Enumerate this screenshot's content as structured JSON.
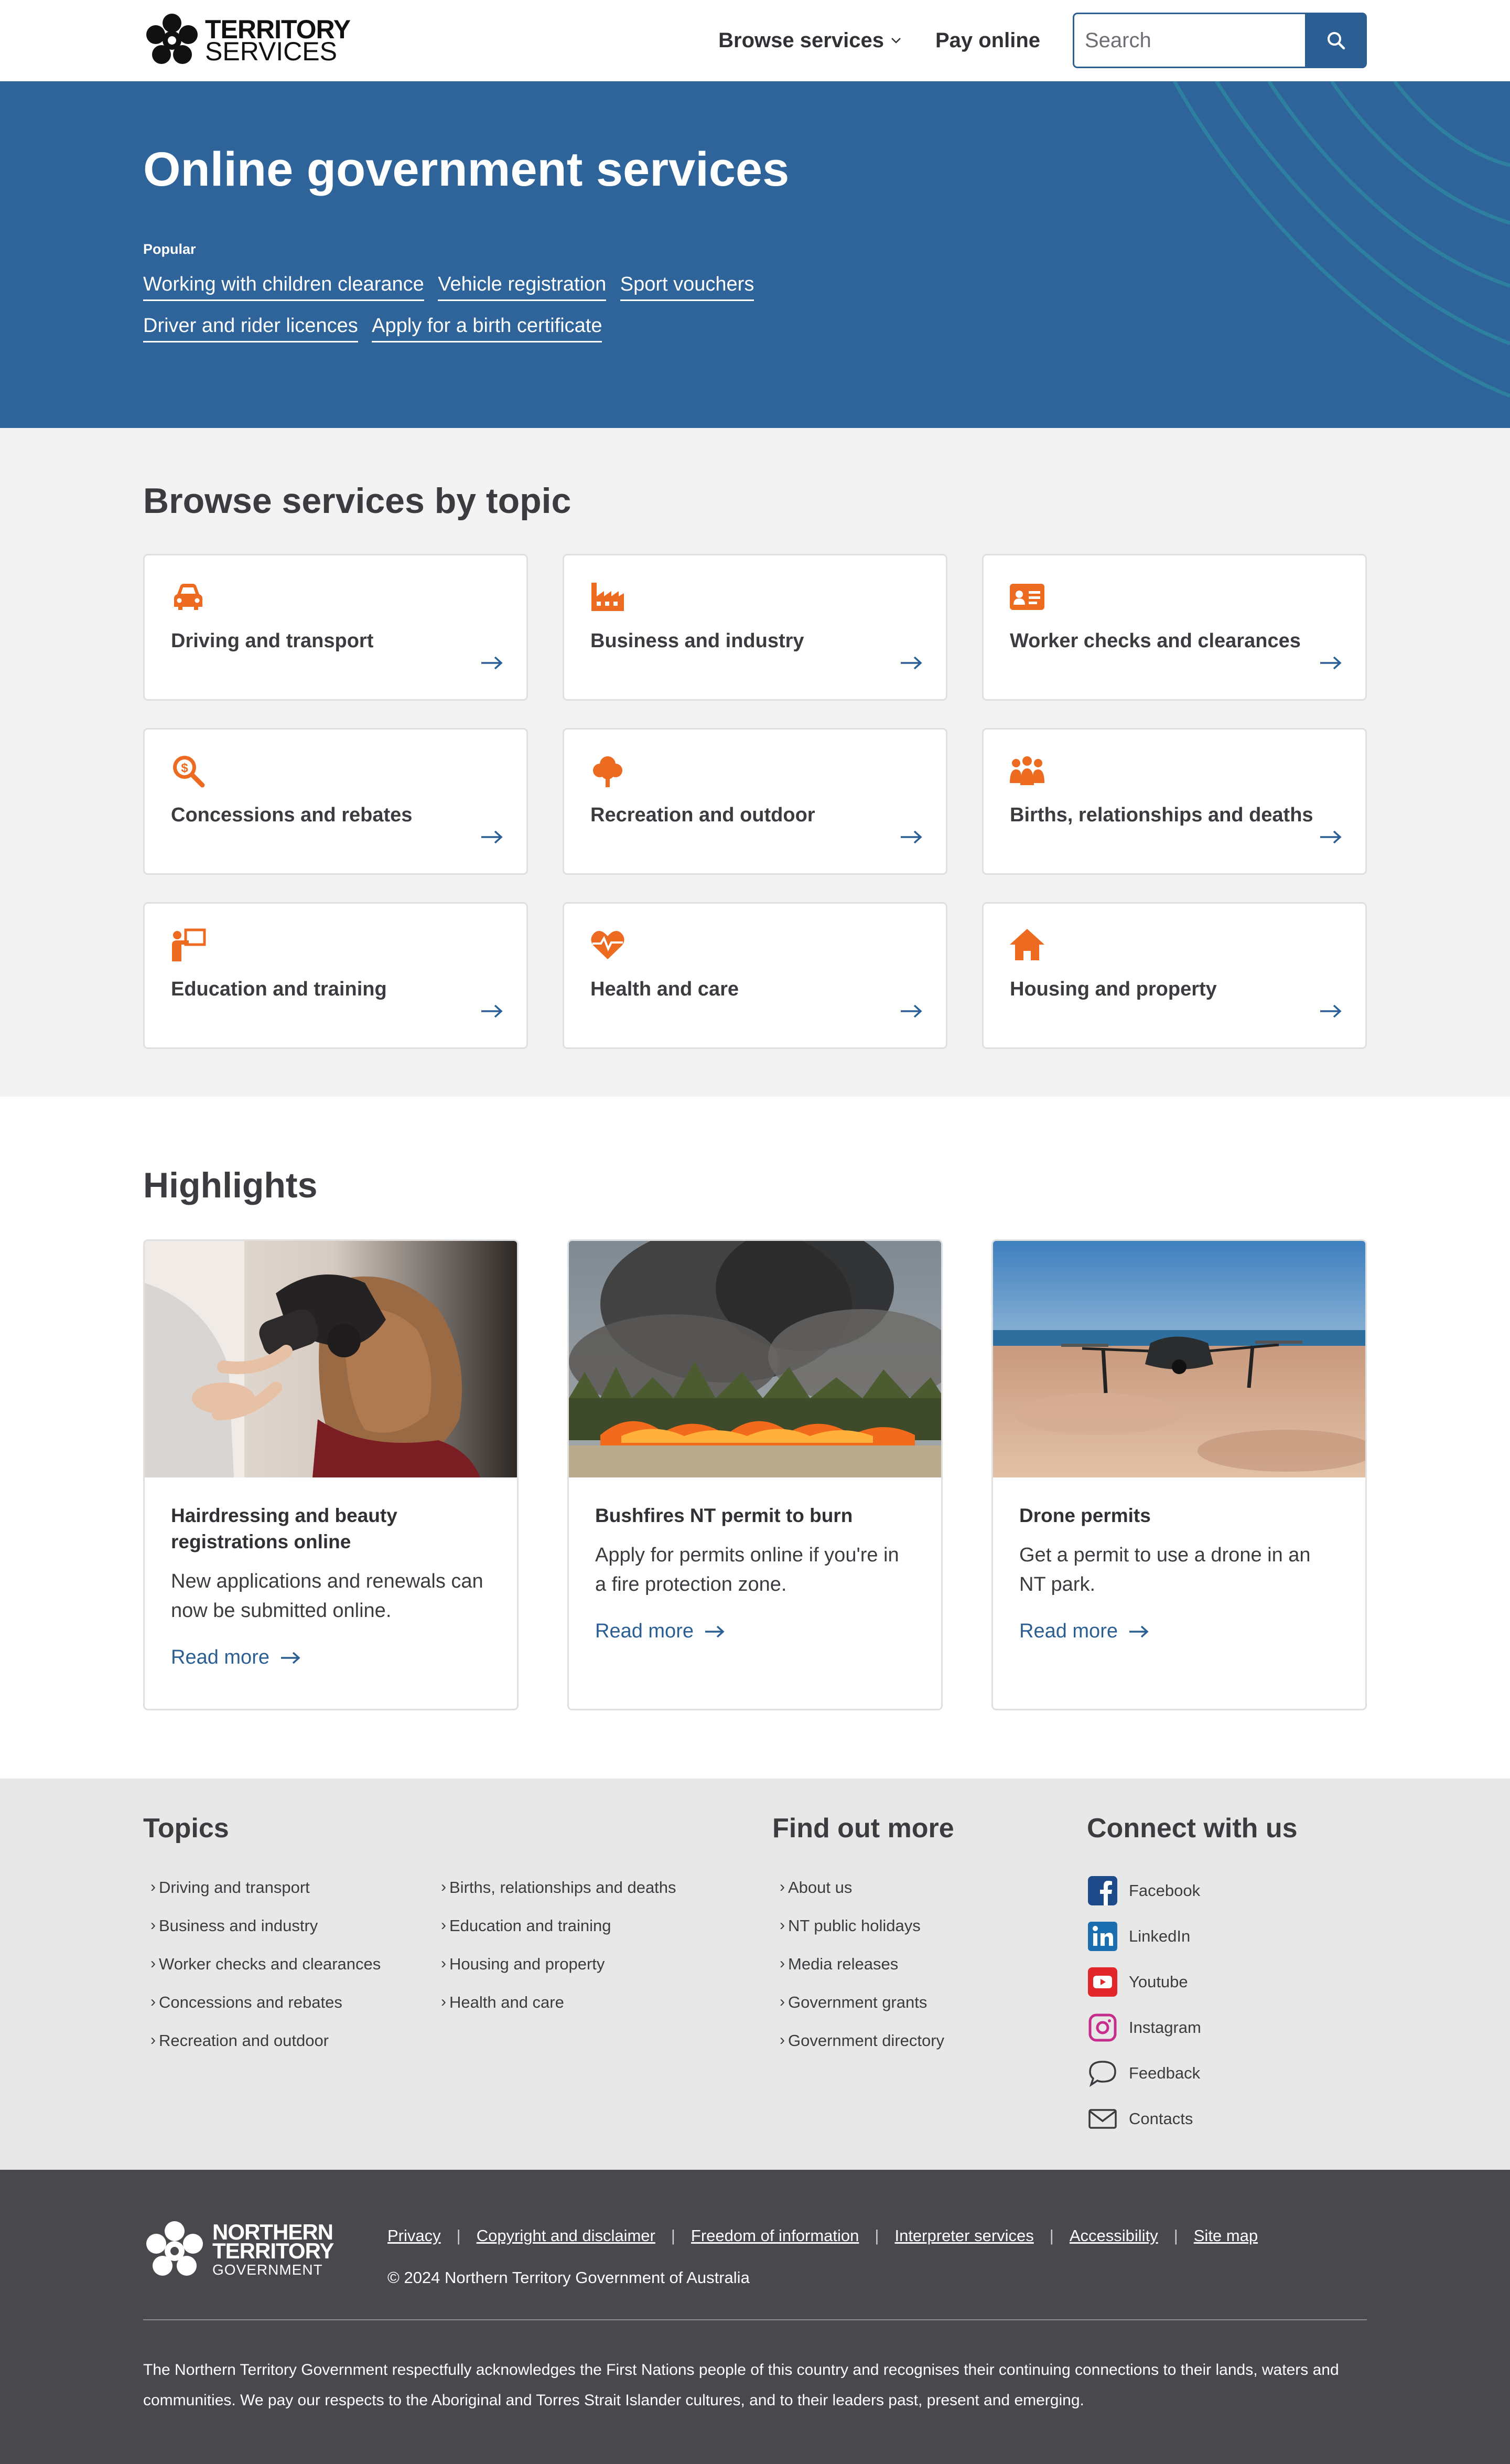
{
  "header": {
    "logo_line1": "TERRITORY",
    "logo_line2": "SERVICES",
    "nav_browse": "Browse services",
    "nav_pay": "Pay online",
    "search_placeholder": "Search"
  },
  "hero": {
    "title": "Online government services",
    "popular_label": "Popular",
    "links": [
      "Working with children clearance",
      "Vehicle registration",
      "Sport vouchers",
      "Driver and rider licences",
      "Apply for a birth certificate"
    ]
  },
  "topics": {
    "title": "Browse services by topic",
    "items": [
      {
        "label": "Driving and transport",
        "icon": "car-icon"
      },
      {
        "label": "Business and industry",
        "icon": "factory-icon"
      },
      {
        "label": "Worker checks and clearances",
        "icon": "id-card-icon"
      },
      {
        "label": "Concessions and rebates",
        "icon": "dollar-search-icon"
      },
      {
        "label": "Recreation and outdoor",
        "icon": "tree-icon"
      },
      {
        "label": "Births, relationships and deaths",
        "icon": "people-icon"
      },
      {
        "label": "Education and training",
        "icon": "teacher-icon"
      },
      {
        "label": "Health and care",
        "icon": "heartbeat-icon"
      },
      {
        "label": "Housing and property",
        "icon": "house-icon"
      }
    ],
    "icon_color": "#ed6b21"
  },
  "highlights": {
    "title": "Highlights",
    "cards": [
      {
        "title": "Hairdressing and beauty registrations online",
        "desc": "New applications and renewals can now be submitted online.",
        "more": "Read more"
      },
      {
        "title": "Bushfires NT permit to burn",
        "desc": "Apply for permits online if you're in a fire protection zone.",
        "more": "Read more"
      },
      {
        "title": "Drone permits",
        "desc": "Get a permit to use a drone in an NT park.",
        "more": "Read more"
      }
    ]
  },
  "footer": {
    "topics_title": "Topics",
    "topics_col1": [
      "Driving and transport",
      "Business and industry",
      "Worker checks and clearances",
      "Concessions and rebates",
      "Recreation and outdoor"
    ],
    "topics_col2": [
      "Births, relationships and deaths",
      "Education and training",
      "Housing and property",
      "Health and care"
    ],
    "find_title": "Find out more",
    "find_items": [
      "About us",
      "NT public holidays",
      "Media releases",
      "Government grants",
      "Government directory"
    ],
    "connect_title": "Connect with us",
    "social": [
      {
        "label": "Facebook",
        "icon": "facebook-icon"
      },
      {
        "label": "LinkedIn",
        "icon": "linkedin-icon"
      },
      {
        "label": "Youtube",
        "icon": "youtube-icon"
      },
      {
        "label": "Instagram",
        "icon": "instagram-icon"
      },
      {
        "label": "Feedback",
        "icon": "speech-bubble-icon"
      },
      {
        "label": "Contacts",
        "icon": "envelope-icon"
      }
    ],
    "nt_logo_1": "NORTHERN",
    "nt_logo_2": "TERRITORY",
    "nt_logo_3": "GOVERNMENT",
    "bottom_links": [
      "Privacy",
      "Copyright and disclaimer",
      "Freedom of information",
      "Interpreter services",
      "Accessibility",
      "Site map"
    ],
    "copyright": "© 2024 Northern Territory Government of Australia",
    "acknowledgement": "The Northern Territory Government respectfully acknowledges the First Nations people of this country and recognises their continuing connections to their lands, waters and communities. We pay our respects to the Aboriginal and Torres Strait Islander cultures, and to their leaders past, present and emerging."
  },
  "colors": {
    "brand_blue": "#2e6499",
    "accent_orange": "#ed6b21",
    "link_blue": "#2b5f94",
    "footer_dark": "#48484d"
  }
}
